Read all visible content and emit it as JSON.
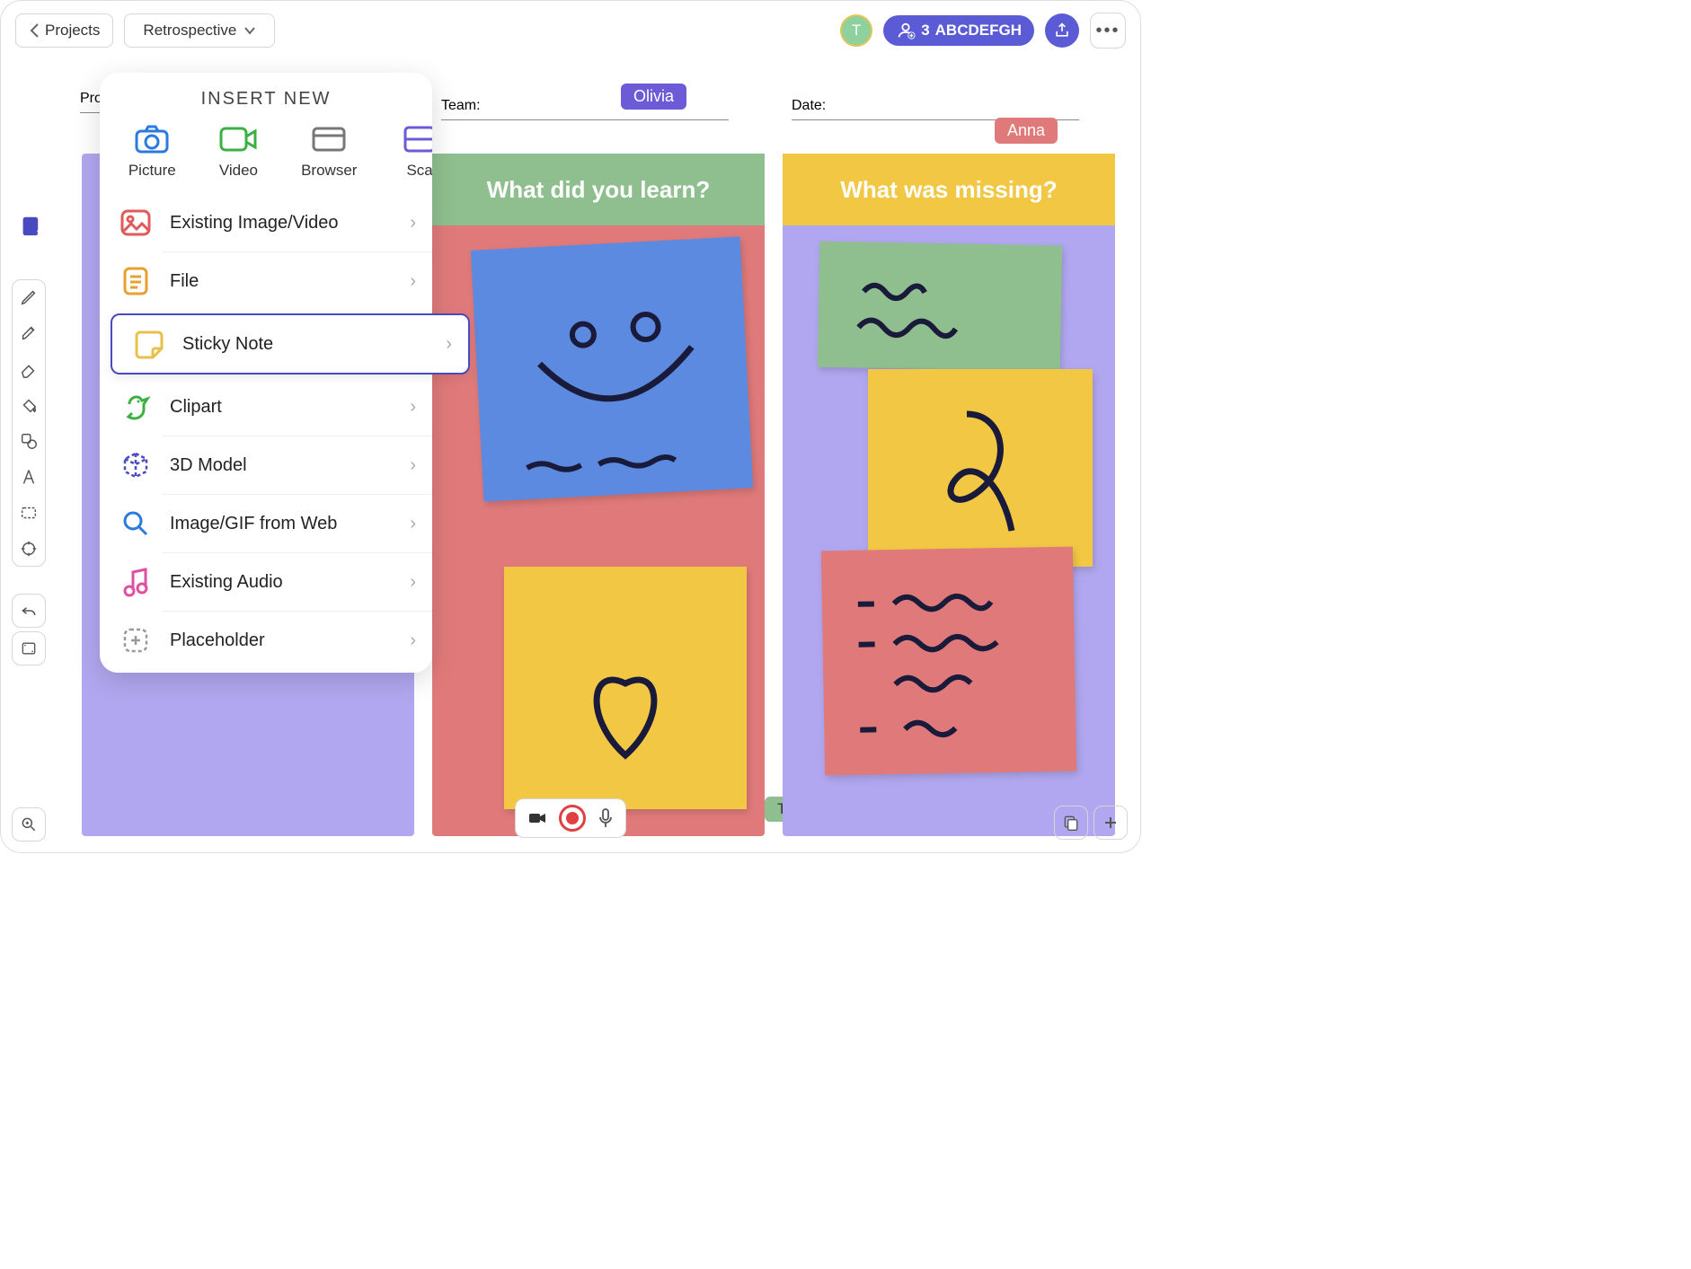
{
  "topbar": {
    "back_label": "Projects",
    "doc_name": "Retrospective",
    "avatar_letter": "T",
    "collab_count": "3",
    "collab_text": "ABCDEFGH"
  },
  "popover": {
    "title": "INSERT NEW",
    "top_items": [
      {
        "label": "Picture",
        "icon": "camera-icon"
      },
      {
        "label": "Video",
        "icon": "video-icon"
      },
      {
        "label": "Browser",
        "icon": "browser-icon"
      },
      {
        "label": "Sca",
        "icon": "scan-icon"
      }
    ],
    "rows": [
      {
        "label": "Existing Image/Video",
        "icon": "image-icon"
      },
      {
        "label": "File",
        "icon": "file-icon"
      },
      {
        "label": "Sticky Note",
        "icon": "sticky-icon",
        "selected": true
      },
      {
        "label": "Clipart",
        "icon": "bird-icon"
      },
      {
        "label": "3D Model",
        "icon": "cube-icon"
      },
      {
        "label": "Image/GIF from Web",
        "icon": "search-icon"
      },
      {
        "label": "Existing Audio",
        "icon": "audio-icon"
      },
      {
        "label": "Placeholder",
        "icon": "placeholder-icon"
      }
    ]
  },
  "canvas": {
    "field_project": "Project:",
    "field_team": "Team:",
    "field_date": "Date:",
    "users": {
      "olivia": "Olivia",
      "anna": "Anna",
      "theodore": "Theodore"
    },
    "columns": [
      {
        "header": ""
      },
      {
        "header": "What did you learn?"
      },
      {
        "header": "What was missing?"
      }
    ]
  },
  "colors": {
    "primary": "#4a4ac0",
    "purple_light": "#b1a7f0",
    "red": "#e07a7a",
    "green": "#8fbf8f",
    "yellow": "#f2c744",
    "blue": "#5b8ae0"
  }
}
